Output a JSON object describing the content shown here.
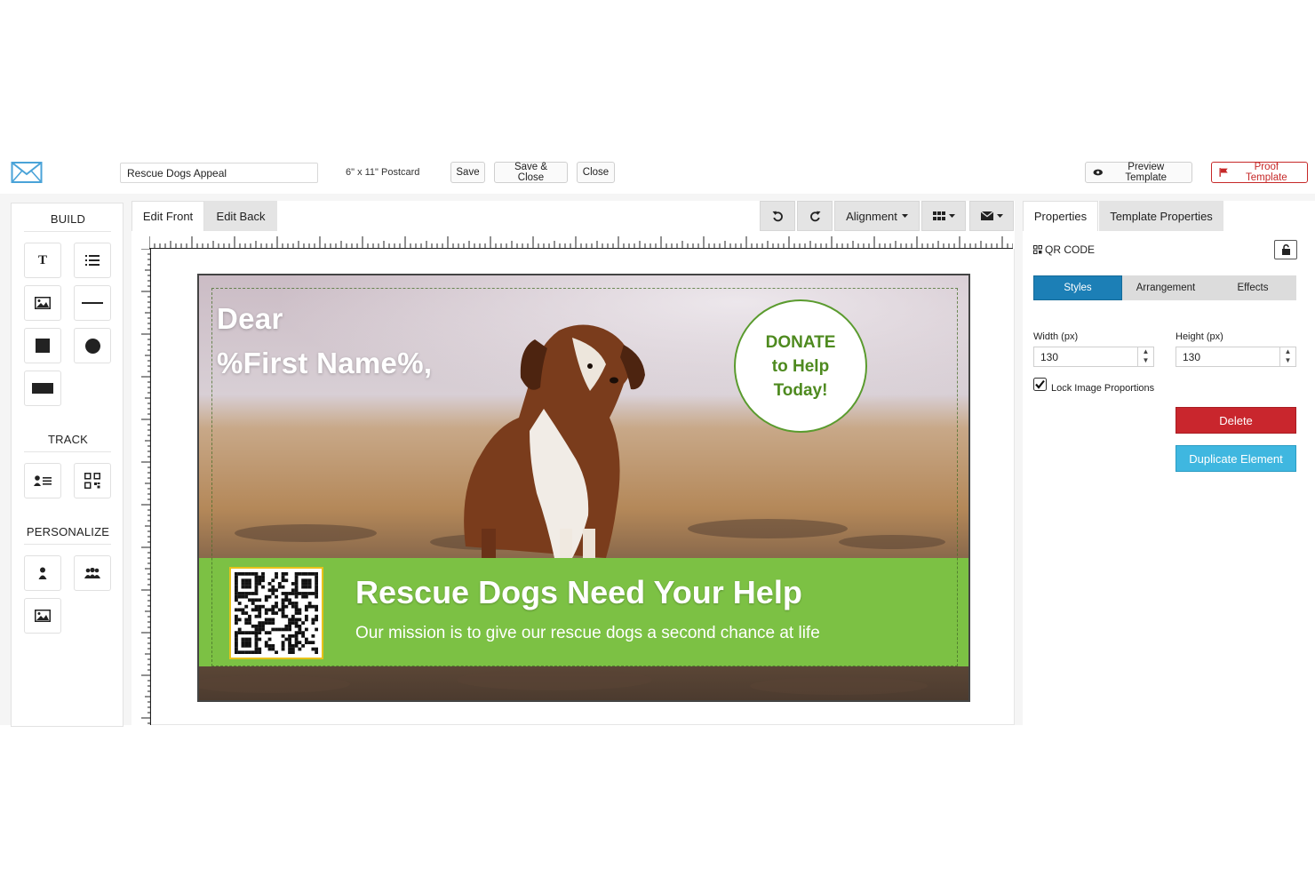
{
  "toolbar": {
    "template_name": "Rescue Dogs Appeal",
    "size_label": "6\" x 11\" Postcard",
    "save_label": "Save",
    "save_close_label": "Save & Close",
    "close_label": "Close",
    "preview_label": "Preview Template",
    "proof_label": "Proof Template"
  },
  "sidebar": {
    "build_title": "BUILD",
    "track_title": "TRACK",
    "personalize_title": "PERSONALIZE",
    "build_tools": [
      "text-icon",
      "list-icon",
      "image-icon",
      "line-icon",
      "square-icon",
      "circle-icon",
      "rectangle-icon"
    ],
    "track_tools": [
      "contact-card-icon",
      "qr-code-icon"
    ],
    "personalize_tools": [
      "person-icon",
      "group-icon",
      "image-icon"
    ]
  },
  "editor": {
    "tab_front": "Edit Front",
    "tab_back": "Edit Back",
    "alignment_label": "Alignment",
    "undo_icon": "undo-icon",
    "redo_icon": "redo-icon",
    "grid_icon": "grid-icon",
    "mail_icon": "envelope-icon"
  },
  "postcard": {
    "greeting_line1": "Dear",
    "greeting_line2": "%First Name%,",
    "donate_line1": "DONATE",
    "donate_line2": "to Help",
    "donate_line3": "Today!",
    "banner_title": "Rescue Dogs Need Your Help",
    "banner_subtitle": "Our mission is to give our rescue dogs a second chance at life"
  },
  "properties": {
    "tab_properties": "Properties",
    "tab_template": "Template Properties",
    "element_label": "QR CODE",
    "subtabs": [
      "Styles",
      "Arrangement",
      "Effects"
    ],
    "width_label": "Width (px)",
    "width_value": "130",
    "height_label": "Height (px)",
    "height_value": "130",
    "lock_label": "Lock Image Proportions",
    "lock_checked": true,
    "delete_label": "Delete",
    "duplicate_label": "Duplicate Element"
  },
  "colors": {
    "banner_green": "#7cc144",
    "donate_green": "#4e8a1f",
    "styles_blue": "#1c7fb6",
    "delete_red": "#c9262d",
    "duplicate_blue": "#3fb7e0",
    "proof_red": "#c62828"
  }
}
